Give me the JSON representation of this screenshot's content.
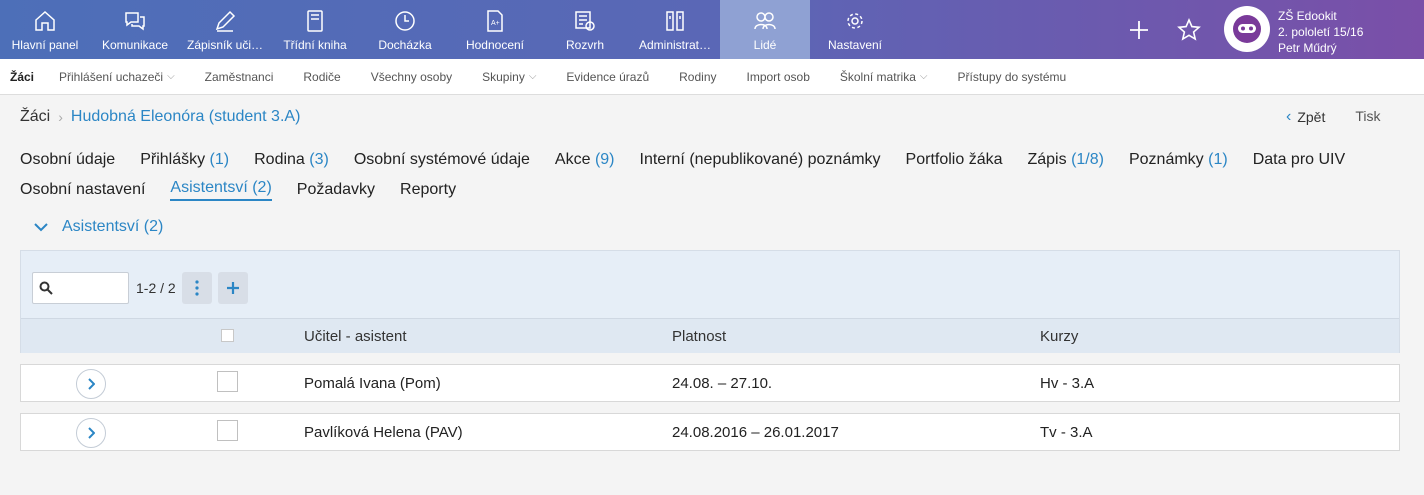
{
  "topnav": {
    "items": [
      {
        "label": "Hlavní panel",
        "icon": "home-icon"
      },
      {
        "label": "Komunikace",
        "icon": "chat-icon"
      },
      {
        "label": "Zápisník uči…",
        "icon": "pen-icon"
      },
      {
        "label": "Třídní kniha",
        "icon": "book-icon"
      },
      {
        "label": "Docházka",
        "icon": "clock-icon"
      },
      {
        "label": "Hodnocení",
        "icon": "grade-icon"
      },
      {
        "label": "Rozvrh",
        "icon": "schedule-icon"
      },
      {
        "label": "Administrat…",
        "icon": "admin-icon"
      },
      {
        "label": "Lidé",
        "icon": "people-icon"
      },
      {
        "label": "Nastavení",
        "icon": "gear-icon"
      }
    ],
    "active_index": 8
  },
  "school": {
    "name": "ZŠ Edookit",
    "term": "2. pololetí 15/16",
    "user": "Petr Műdrý"
  },
  "subnav": {
    "items": [
      "Žáci",
      "Přihlášení uchazeči",
      "Zaměstnanci",
      "Rodiče",
      "Všechny osoby",
      "Skupiny",
      "Evidence úrazů",
      "Rodiny",
      "Import osob",
      "Školní matrika",
      "Přístupy do systému"
    ]
  },
  "breadcrumb": {
    "root": "Žáci",
    "current": "Hudobná Eleonóra  (student 3.A)"
  },
  "actions": {
    "back": "Zpět",
    "print": "Tisk"
  },
  "tabs": {
    "row1": [
      {
        "label": "Osobní údaje",
        "count": ""
      },
      {
        "label": "Přihlášky",
        "count": "(1)"
      },
      {
        "label": "Rodina",
        "count": "(3)"
      },
      {
        "label": "Osobní systémové údaje",
        "count": ""
      },
      {
        "label": "Akce",
        "count": "(9)"
      },
      {
        "label": "Interní (nepublikované) poznámky",
        "count": ""
      },
      {
        "label": "Portfolio žáka",
        "count": ""
      },
      {
        "label": "Zápis",
        "count": "(1/8)"
      },
      {
        "label": "Poznámky",
        "count": "(1)"
      },
      {
        "label": "Data pro UIV",
        "count": ""
      }
    ],
    "row2": [
      {
        "label": "Osobní nastavení",
        "count": ""
      },
      {
        "label": "Asistentsví (2)",
        "count": ""
      },
      {
        "label": "Požadavky",
        "count": ""
      },
      {
        "label": "Reporty",
        "count": ""
      }
    ]
  },
  "section": {
    "title": "Asistentsví (2)"
  },
  "table": {
    "pager": "1-2 / 2",
    "columns": [
      "Učitel - asistent",
      "Platnost",
      "Kurzy"
    ],
    "rows": [
      {
        "teacher": "Pomalá Ivana (Pom)",
        "validity": "24.08. – 27.10.",
        "courses": "Hv - 3.A"
      },
      {
        "teacher": "Pavlíková Helena (PAV)",
        "validity": "24.08.2016 – 26.01.2017",
        "courses": "Tv - 3.A"
      }
    ]
  },
  "colors": {
    "accent": "#2b86c5",
    "nav_start": "#4d6fb8",
    "nav_end": "#7a4fa8"
  }
}
